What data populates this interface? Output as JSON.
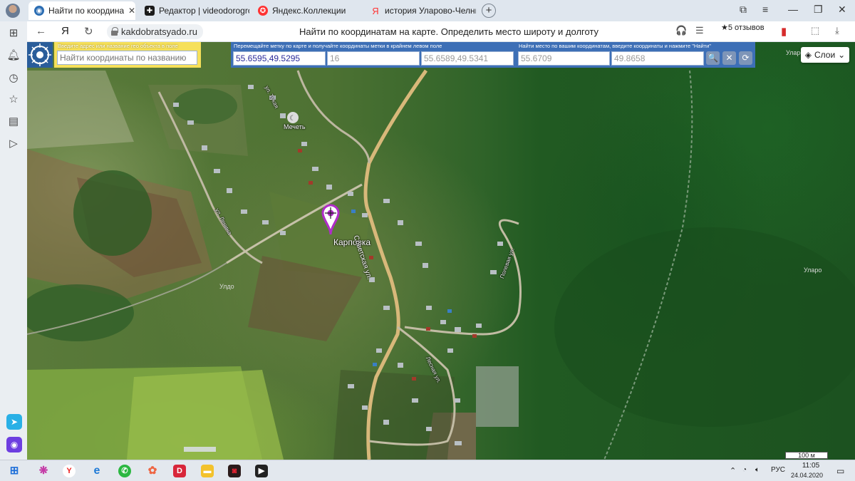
{
  "browser": {
    "tabs": [
      {
        "title": "Найти по координатам",
        "close": "✕",
        "fav_color": "#2b6db3",
        "fav_glyph": "◉"
      },
      {
        "title": "Редактор | videodorogross",
        "fav_color": "#1b1b1b",
        "fav_glyph": "✚"
      },
      {
        "title": "Яндекс.Коллекции",
        "fav_color": "#f33",
        "fav_glyph": "✪"
      },
      {
        "title": "история Уларово-Челны",
        "fav_color": "#f33",
        "fav_glyph": "Я"
      }
    ],
    "new_tab": "+",
    "url": "kakdobratsyado.ru",
    "page_title": "Найти по координатам на карте. Определить место широту и долготу",
    "reviews": "★5 отзывов",
    "nav_back": "←",
    "nav_yandex": "Я",
    "nav_reload": "↻"
  },
  "toolbar": {
    "search": {
      "hint": "Введите адрес или название гео объекта в поле",
      "placeholder": "Найти координаты по названию"
    },
    "mark": {
      "hint": "Перемещайте метку по карте и получайте координаты метки в крайнем левом поле",
      "coords": "55.6595,49.5295",
      "zoom": "16",
      "center": "55.6589,49.5341"
    },
    "find": {
      "hint": "Найти место по вашим координатам, введите координаты и нажмите \"Найти\"",
      "lat": "55.6709",
      "lon": "49.8658"
    },
    "search_btn": "🔍",
    "clear_btn": "✕",
    "refresh_btn": "⟳"
  },
  "map": {
    "layers_label": "Слои",
    "labels": {
      "village": "Карповка",
      "mosque": "Мечеть",
      "street_sovetskaya": "Советская ул.",
      "street_lenina": "ул. Ленина",
      "street_a": "ул. Тукая",
      "street_b": "Полевая ул.",
      "street_c": "Лесная ул.",
      "uldo_1": "Уларо",
      "uldo_2": "Улдо",
      "uldo_3": "Уларо"
    },
    "scale": "100 м"
  },
  "taskbar": {
    "language": "РУС",
    "time": "11:05",
    "date": "24.04.2020"
  },
  "colors": {
    "accent_yellow": "#f6e05a",
    "accent_blue": "#3d6fb6",
    "marker": "#b02cc8"
  }
}
